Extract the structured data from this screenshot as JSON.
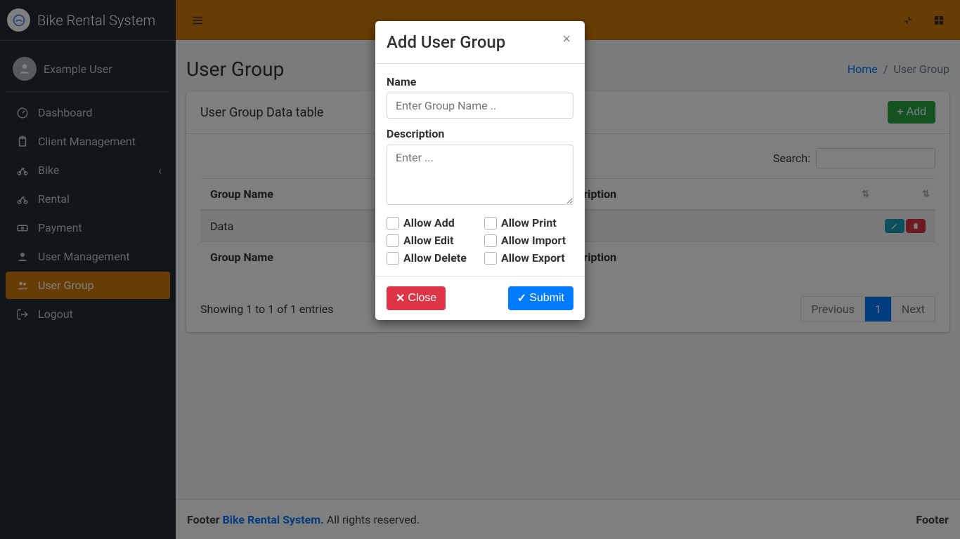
{
  "brand": {
    "text": "Bike Rental System"
  },
  "user": {
    "name": "Example User"
  },
  "nav": {
    "dashboard": "Dashboard",
    "client_management": "Client Management",
    "bike": "Bike",
    "rental": "Rental",
    "payment": "Payment",
    "user_management": "User Management",
    "user_group": "User Group",
    "logout": "Logout"
  },
  "header": {
    "title": "User Group",
    "breadcrumb_home": "Home",
    "breadcrumb_current": "User Group"
  },
  "card": {
    "title": "User Group Data table",
    "add_btn": "Add",
    "search_label": "Search:",
    "columns": {
      "group_name": "Group Name",
      "description": "Description"
    },
    "rows": [
      {
        "group_name": "Data",
        "description": ""
      }
    ],
    "footer_cols": {
      "group_name": "Group Name",
      "description": "Description"
    },
    "showing": "Showing 1 to 1 of 1 entries",
    "pagination": {
      "prev": "Previous",
      "page1": "1",
      "next": "Next"
    }
  },
  "footer": {
    "left_prefix": "Footer ",
    "brand": "Bike Rental System.",
    "left_suffix": " All rights reserved.",
    "right": "Footer"
  },
  "modal": {
    "title": "Add User Group",
    "name_label": "Name",
    "name_placeholder": "Enter Group Name ..",
    "desc_label": "Description",
    "desc_placeholder": "Enter ...",
    "perms": {
      "allow_add": "Allow Add",
      "allow_edit": "Allow Edit",
      "allow_delete": "Allow Delete",
      "allow_print": "Allow Print",
      "allow_import": "Allow Import",
      "allow_export": "Allow Export"
    },
    "close_btn": "Close",
    "submit_btn": "Submit"
  }
}
